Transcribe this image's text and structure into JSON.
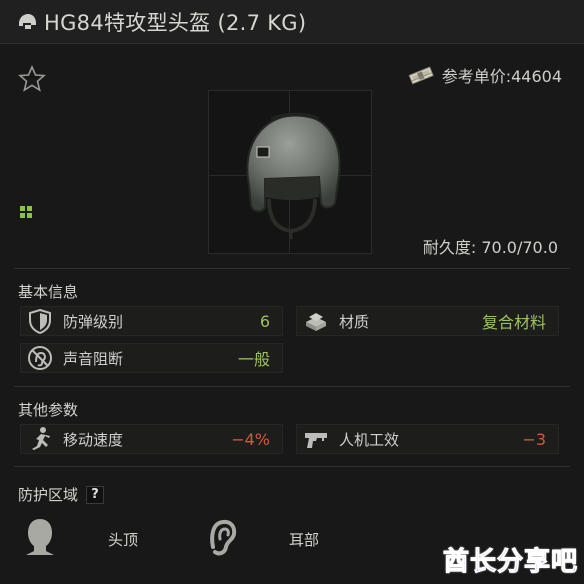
{
  "window": {
    "title": "HG84特攻型头盔 (2.7 KG)",
    "title_icon": "helmet-icon"
  },
  "info": {
    "favorite_icon": "star-outline-icon",
    "price_icon": "money-stack-icon",
    "price_text": "参考单价:44604",
    "durability_text": "耐久度: 70.0/70.0",
    "grid_icon": "grid-size-icon"
  },
  "basic": {
    "heading": "基本信息",
    "stats": [
      {
        "icon": "shield-icon",
        "label": "防弹级别",
        "value": "6"
      },
      {
        "icon": "material-icon",
        "label": "材质",
        "value": "复合材料"
      },
      {
        "icon": "muted-ear-icon",
        "label": "声音阻断",
        "value": "一般"
      }
    ]
  },
  "other": {
    "heading": "其他参数",
    "stats": [
      {
        "icon": "running-man-icon",
        "label": "移动速度",
        "value": "−4%"
      },
      {
        "icon": "pistol-icon",
        "label": "人机工效",
        "value": "−3"
      }
    ]
  },
  "protection": {
    "heading": "防护区域",
    "help_label": "?",
    "zones": [
      {
        "icon": "head-top-icon",
        "label": "头顶"
      },
      {
        "icon": "ear-icon",
        "label": "耳部"
      }
    ]
  },
  "watermark": {
    "main": "酋长分享吧"
  },
  "colors": {
    "positive": "#9cc25d",
    "negative": "#d2593b",
    "watermark": "#1e3fcf"
  }
}
